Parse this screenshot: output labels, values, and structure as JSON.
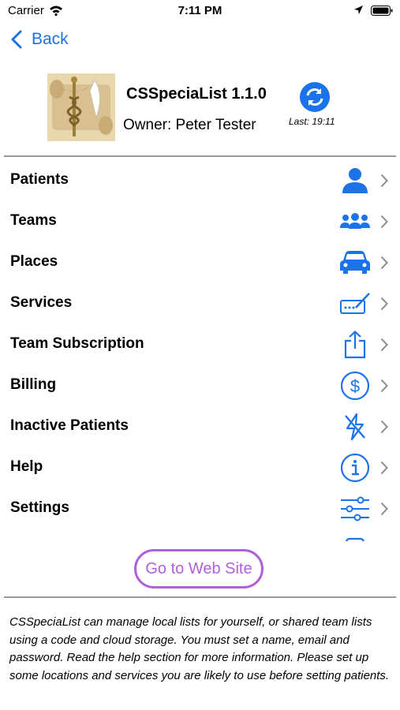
{
  "status_bar": {
    "carrier": "Carrier",
    "time": "7:11 PM"
  },
  "nav": {
    "back_label": "Back"
  },
  "header": {
    "app_title": "CSSpeciaList 1.1.0",
    "owner_label": "Owner:  Peter Tester",
    "last_sync": "Last: 19:11"
  },
  "menu": {
    "items": [
      {
        "label": "Patients",
        "icon": "person-icon"
      },
      {
        "label": "Teams",
        "icon": "people-icon"
      },
      {
        "label": "Places",
        "icon": "car-icon"
      },
      {
        "label": "Services",
        "icon": "signature-icon"
      },
      {
        "label": "Team Subscription",
        "icon": "share-icon"
      },
      {
        "label": "Billing",
        "icon": "dollar-circle-icon"
      },
      {
        "label": "Inactive Patients",
        "icon": "bolt-slash-icon"
      },
      {
        "label": "Help",
        "icon": "info-circle-icon"
      },
      {
        "label": "Settings",
        "icon": "sliders-icon"
      }
    ]
  },
  "web_button": {
    "label": "Go to Web Site"
  },
  "info_text": "CSSpeciaList can manage local lists for yourself, or shared team lists using a code and cloud storage. You must set a name, email and password. Read the help section for more information. Please set up some locations and services you are likely to use before setting patients.",
  "colors": {
    "accent": "#1a73e8",
    "web_button": "#b061d8",
    "divider": "#9a9a9a"
  }
}
